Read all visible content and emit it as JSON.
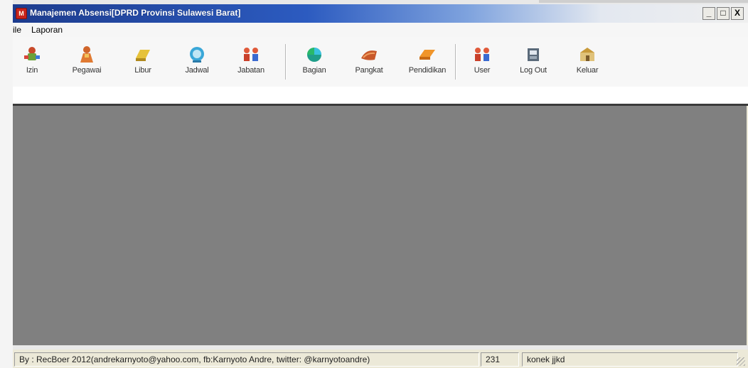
{
  "window": {
    "title": "Manajemen Absensi[DPRD Provinsi Sulawesi Barat]",
    "controls": {
      "minimize": "_",
      "restore": "□",
      "close": "X"
    }
  },
  "menu": [
    {
      "label": "ile"
    },
    {
      "label": "Laporan"
    }
  ],
  "toolbar": {
    "items": [
      {
        "label": "Izin",
        "icon": "izin-icon"
      },
      {
        "label": "Pegawai",
        "icon": "pegawai-icon"
      },
      {
        "label": "Libur",
        "icon": "libur-icon"
      },
      {
        "label": "Jadwal",
        "icon": "jadwal-icon"
      },
      {
        "label": "Jabatan",
        "icon": "jabatan-icon"
      },
      {
        "label": "Bagian",
        "icon": "bagian-icon"
      },
      {
        "label": "Pangkat",
        "icon": "pangkat-icon"
      },
      {
        "label": "Pendidikan",
        "icon": "pendidikan-icon"
      },
      {
        "label": "User",
        "icon": "user-icon"
      },
      {
        "label": "Log Out",
        "icon": "logout-icon"
      },
      {
        "label": "Keluar",
        "icon": "keluar-icon"
      }
    ]
  },
  "status": {
    "credit": "By : RecBoer 2012(andrekarnyoto@yahoo.com, fb:Karnyoto Andre, twitter: @karnyotoandre)",
    "count": "231",
    "connection": "konek jjkd"
  },
  "colors": {
    "titlebar_start": "#1d3c8e",
    "mdi_background": "#808080",
    "chrome": "#ece9d8"
  }
}
